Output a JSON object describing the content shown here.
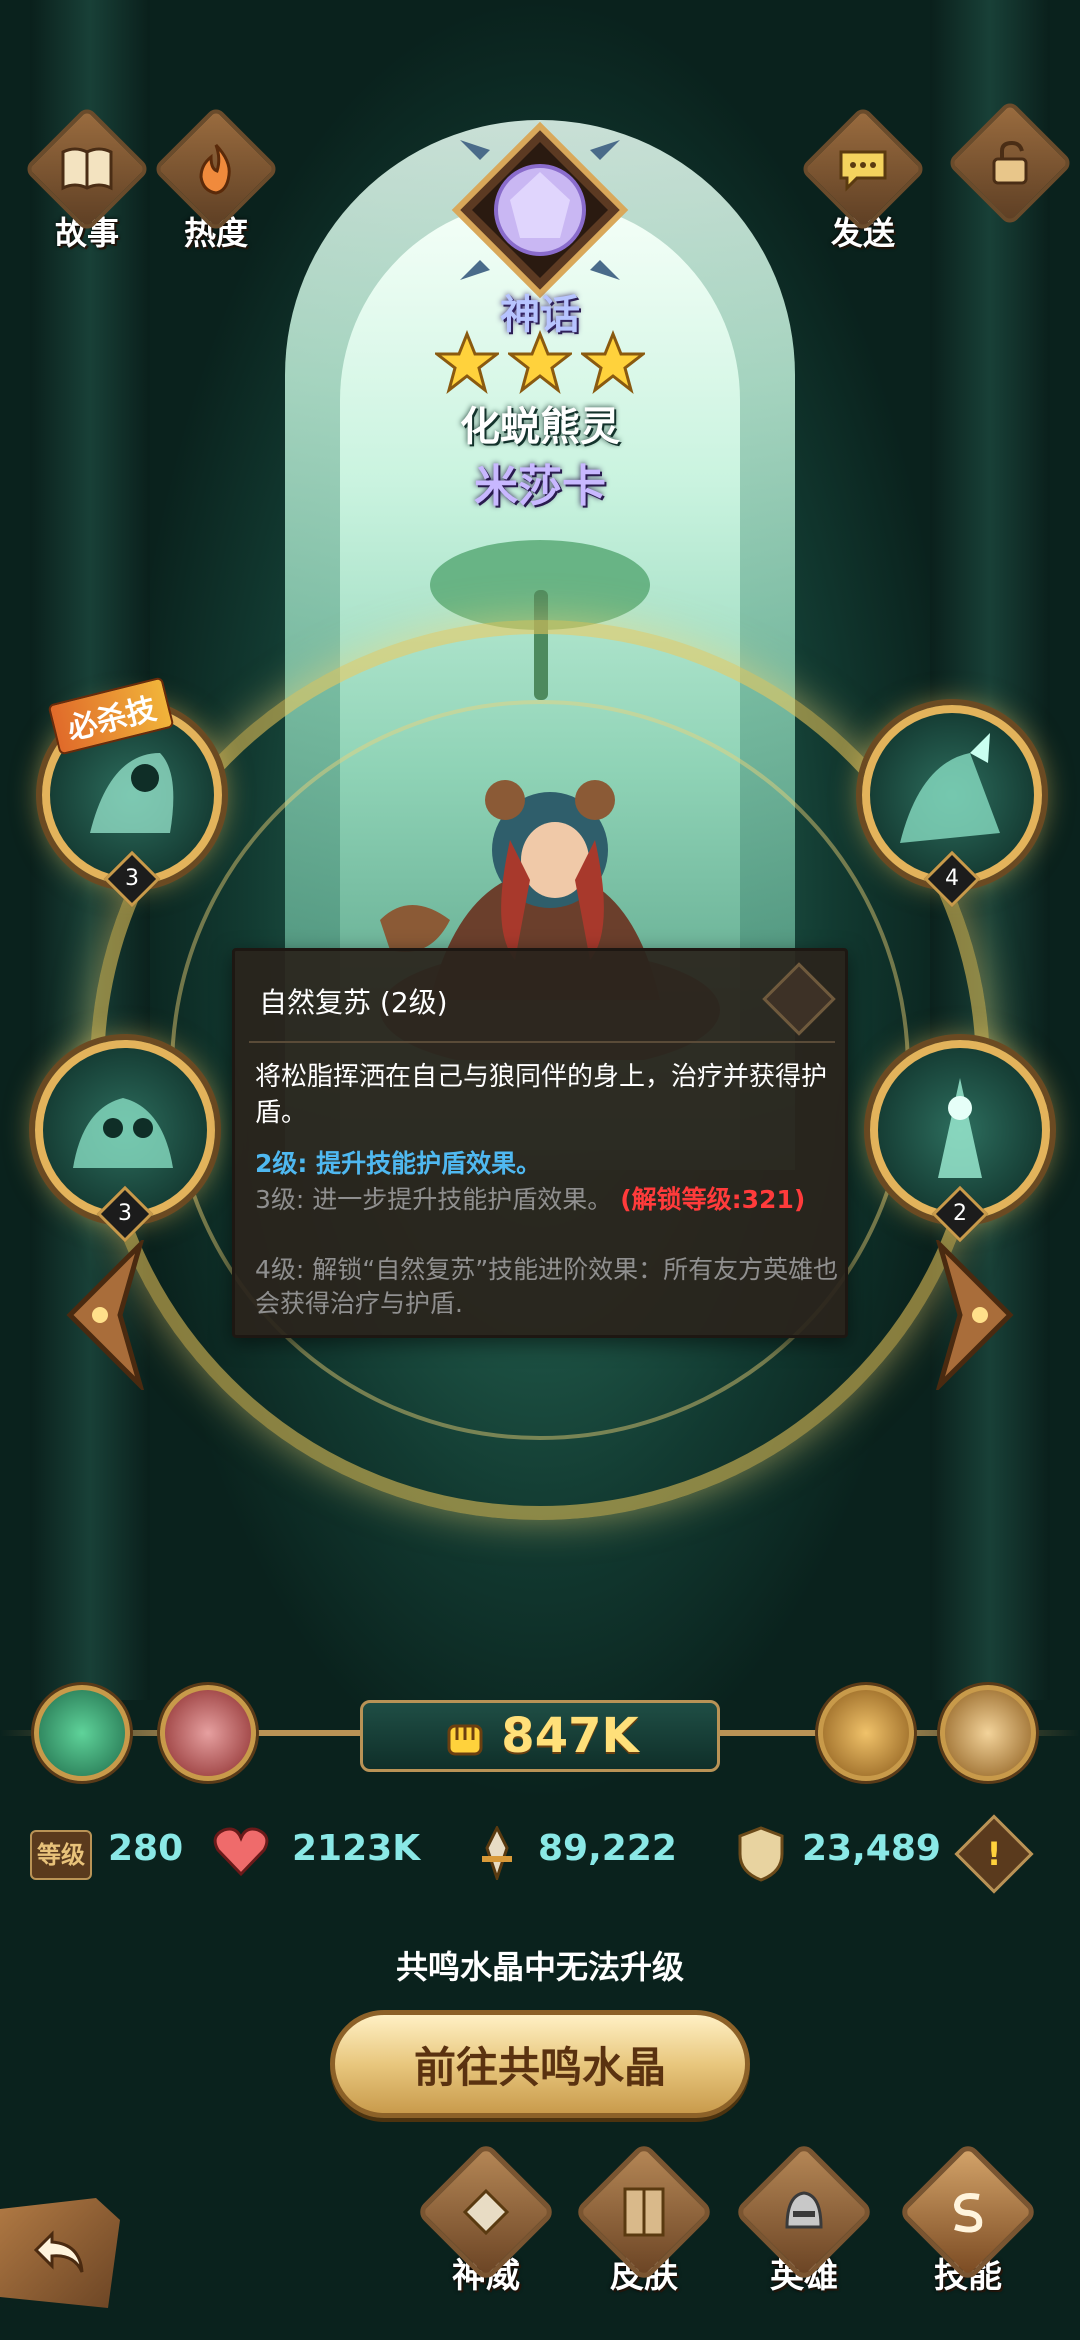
{
  "header": {
    "story_label": "故事",
    "heat_label": "热度",
    "send_label": "发送"
  },
  "hero": {
    "rarity": "神话",
    "star_count": 3,
    "title": "化蜕熊灵",
    "name": "米莎卡"
  },
  "skills": {
    "ultimate_tag": "必杀技",
    "left_top_level": "3",
    "left_bottom_level": "3",
    "right_top_level": "4",
    "right_bottom_level": "2"
  },
  "tooltip": {
    "title": "自然复苏 (2级)",
    "description": "将松脂挥洒在自己与狼同伴的身上，治疗并获得护盾。",
    "level2": "2级: 提升技能护盾效果。",
    "level3": "3级: 进一步提升技能护盾效果。",
    "level3_lock": "(解锁等级:321)",
    "level4": "4级: 解锁“自然复苏”技能进阶效果：所有友方英雄也会获得治疗与护盾."
  },
  "power": {
    "value": "847K"
  },
  "stats": {
    "level_label": "等级",
    "level": "280",
    "hp": "2123K",
    "attack": "89,222",
    "defense": "23,489"
  },
  "notice": "共鸣水晶中无法升级",
  "go_button": "前往共鸣水晶",
  "bottom_nav": {
    "divine_label": "神威",
    "skin_label": "皮肤",
    "hero_label": "英雄",
    "skill_label": "技能"
  },
  "colors": {
    "stat_value": "#8ae8e6",
    "level2_text": "#4fb8f0",
    "locked_text": "#8f8f8f",
    "lock_red": "#ff3b3b",
    "gold": "#e3b35b"
  }
}
